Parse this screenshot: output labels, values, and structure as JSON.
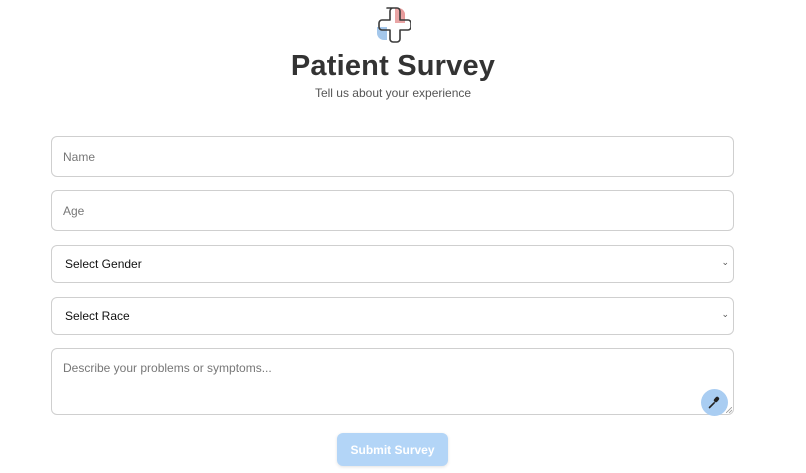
{
  "header": {
    "title": "Patient Survey",
    "subtitle": "Tell us about your experience",
    "logo_icon": "medical-cross-icon"
  },
  "form": {
    "name": {
      "placeholder": "Name",
      "value": ""
    },
    "age": {
      "placeholder": "Age",
      "value": ""
    },
    "gender": {
      "selected": "Select Gender"
    },
    "race": {
      "selected": "Select Race"
    },
    "problems": {
      "placeholder": "Describe your problems or symptoms...",
      "value": ""
    },
    "mic_icon": "microphone-icon",
    "submit_label": "Submit Survey"
  },
  "colors": {
    "accent": "#a9cdf2",
    "submit_bg": "#b3d5f7",
    "logo_red": "#e79b9b",
    "logo_blue": "#9fc4ea",
    "border": "#cfcfcf"
  }
}
